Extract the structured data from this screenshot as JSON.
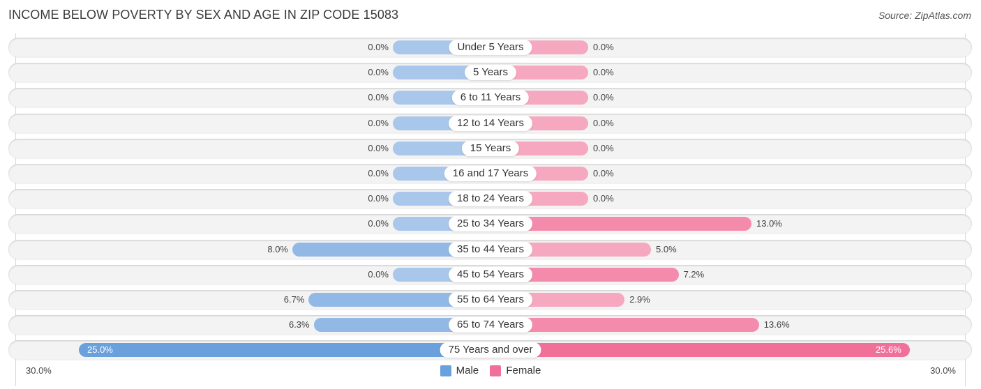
{
  "chart_data": {
    "type": "bar",
    "orientation": "horizontal-diverging",
    "title": "INCOME BELOW POVERTY BY SEX AND AGE IN ZIP CODE 15083",
    "source": "Source: ZipAtlas.com",
    "categories": [
      "Under 5 Years",
      "5 Years",
      "6 to 11 Years",
      "12 to 14 Years",
      "15 Years",
      "16 and 17 Years",
      "18 to 24 Years",
      "25 to 34 Years",
      "35 to 44 Years",
      "45 to 54 Years",
      "55 to 64 Years",
      "65 to 74 Years",
      "75 Years and over"
    ],
    "series": [
      {
        "name": "Male",
        "color": "#6aa0dc",
        "values": [
          0.0,
          0.0,
          0.0,
          0.0,
          0.0,
          0.0,
          0.0,
          0.0,
          8.0,
          0.0,
          6.7,
          6.3,
          25.0
        ]
      },
      {
        "name": "Female",
        "color": "#f0709a",
        "values": [
          0.0,
          0.0,
          0.0,
          0.0,
          0.0,
          0.0,
          0.0,
          13.0,
          5.0,
          7.2,
          2.9,
          13.6,
          25.6
        ]
      }
    ],
    "value_labels": {
      "male": [
        "0.0%",
        "0.0%",
        "0.0%",
        "0.0%",
        "0.0%",
        "0.0%",
        "0.0%",
        "0.0%",
        "8.0%",
        "0.0%",
        "6.7%",
        "6.3%",
        "25.0%"
      ],
      "female": [
        "0.0%",
        "0.0%",
        "0.0%",
        "0.0%",
        "0.0%",
        "0.0%",
        "0.0%",
        "13.0%",
        "5.0%",
        "7.2%",
        "2.9%",
        "13.6%",
        "25.6%"
      ]
    },
    "axis": {
      "left_label": "30.0%",
      "right_label": "30.0%",
      "range": [
        0,
        30
      ],
      "unit": "%"
    },
    "legend": {
      "position": "bottom-center",
      "entries": [
        "Male",
        "Female"
      ]
    },
    "grid": false
  }
}
